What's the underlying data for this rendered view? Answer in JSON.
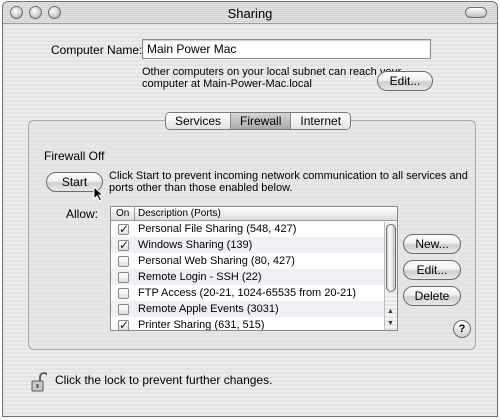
{
  "window": {
    "title": "Sharing"
  },
  "computer_name": {
    "label": "Computer Name:",
    "value": "Main Power Mac",
    "note_line1": "Other computers on your local subnet can reach your",
    "note_line2": "computer at Main-Power-Mac.local",
    "edit_label": "Edit..."
  },
  "tabs": [
    {
      "label": "Services",
      "selected": false
    },
    {
      "label": "Firewall",
      "selected": true
    },
    {
      "label": "Internet",
      "selected": false
    }
  ],
  "firewall": {
    "status": "Firewall Off",
    "start_label": "Start",
    "info_line1": "Click Start to prevent incoming network communication to all services and",
    "info_line2": "ports other than those enabled below.",
    "allow_label": "Allow:"
  },
  "table": {
    "col_on": "On",
    "col_desc": "Description (Ports)",
    "rows": [
      {
        "label": "Personal File Sharing (548, 427)",
        "checked": true
      },
      {
        "label": "Windows Sharing (139)",
        "checked": true
      },
      {
        "label": "Personal Web Sharing (80, 427)",
        "checked": false
      },
      {
        "label": "Remote Login - SSH (22)",
        "checked": false
      },
      {
        "label": "FTP Access (20-21, 1024-65535 from 20-21)",
        "checked": false
      },
      {
        "label": "Remote Apple Events (3031)",
        "checked": false
      },
      {
        "label": "Printer Sharing (631, 515)",
        "checked": true
      }
    ]
  },
  "actions": {
    "new_label": "New...",
    "edit_label": "Edit...",
    "delete_label": "Delete"
  },
  "help": {
    "label": "?"
  },
  "footer": {
    "lock_text": "Click the lock to prevent further changes."
  },
  "icons": {
    "lock": "lock-icon",
    "help": "help-icon",
    "cursor": "pointer-cursor-icon"
  }
}
